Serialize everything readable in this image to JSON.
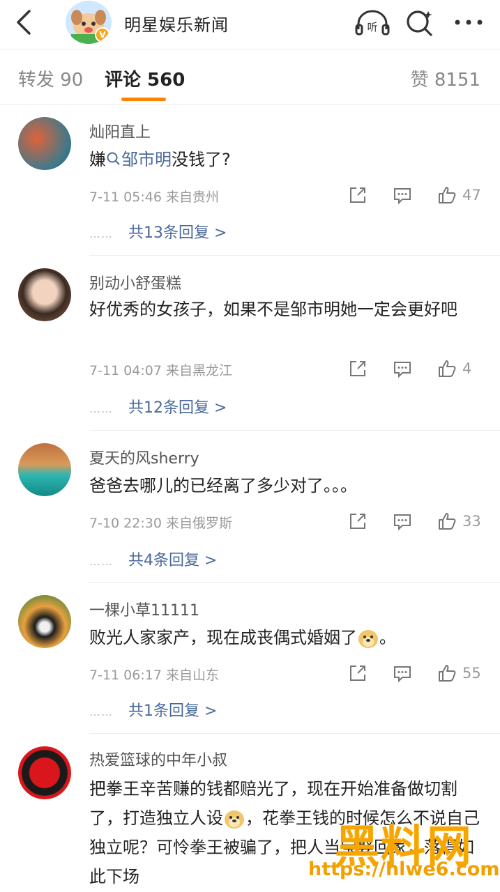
{
  "header": {
    "account_name": "明星娱乐新闻",
    "verified_badge": "V",
    "listen_label": "听"
  },
  "tabs": {
    "repost": "转发 90",
    "comments": "评论 560",
    "likes": "赞 8151"
  },
  "comments": [
    {
      "name": "灿阳直上",
      "text_before": "嫌",
      "mention": "邹市明",
      "text_after": "没钱了?",
      "meta": "7-11 05:46  来自贵州",
      "likes": "47",
      "replies": "共13条回复 >"
    },
    {
      "name": "别动小舒蛋糕",
      "text": "好优秀的女孩子，如果不是邹市明她一定会更好吧",
      "meta": "7-11 04:07  来自黑龙江",
      "likes": "4",
      "replies": "共12条回复 >"
    },
    {
      "name": "夏天的风sherry",
      "text": "爸爸去哪儿的已经离了多少对了。。。",
      "meta": "7-10 22:30  来自俄罗斯",
      "likes": "33",
      "replies": "共4条回复 >"
    },
    {
      "name": "一棵小草11111",
      "text_before": "败光人家家产，现在成丧偶式婚姻了",
      "text_after": "。",
      "meta": "7-11 06:17  来自山东",
      "likes": "55",
      "replies": "共1条回复 >"
    },
    {
      "name": "热爱篮球的中年小叔",
      "text_before": "把拳王辛苦赚的钱都赔光了，现在开始准备做切割了，打造独立人设",
      "text_after": "，花拳王钱的时候怎么不说自己独立呢？可怜拳王被骗了，把人当宝娶回家，落得如此下场"
    }
  ],
  "reply_dots": "……",
  "watermark": {
    "brand": "黑料网",
    "url": "https://hlwe6.com"
  }
}
